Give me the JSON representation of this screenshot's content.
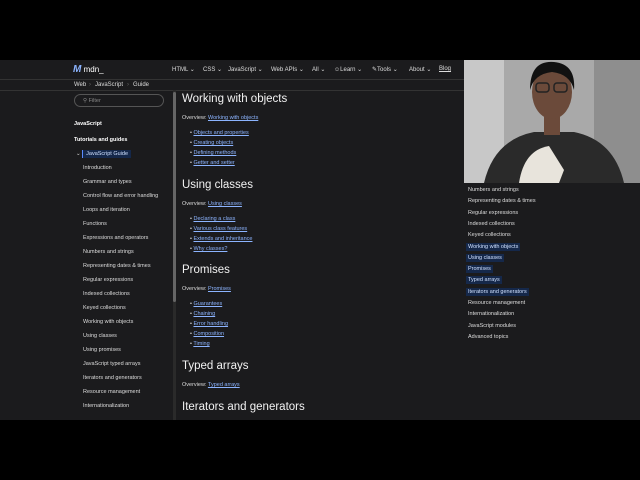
{
  "header": {
    "logo": "mdn_",
    "nav": [
      "HTML",
      "CSS",
      "JavaScript",
      "Web APIs",
      "All",
      "Learn",
      "Tools",
      "About"
    ],
    "blog": "Blog"
  },
  "breadcrumb": [
    "Web",
    "JavaScript",
    "Guide"
  ],
  "sidebar": {
    "filter_placeholder": "Filter",
    "section": "JavaScript",
    "group": "Tutorials and guides",
    "guide": "JavaScript Guide",
    "items": [
      "Introduction",
      "Grammar and types",
      "Control flow and error handling",
      "Loops and iteration",
      "Functions",
      "Expressions and operators",
      "Numbers and strings",
      "Representing dates & times",
      "Regular expressions",
      "Indexed collections",
      "Keyed collections",
      "Working with objects",
      "Using classes",
      "Using promises",
      "JavaScript typed arrays",
      "Iterators and generators",
      "Resource management",
      "Internationalization"
    ]
  },
  "main": {
    "overview_label": "Overview:",
    "sections": [
      {
        "title": "Working with objects",
        "overview": "Working with objects",
        "links": [
          "Objects and properties",
          "Creating objects",
          "Defining methods",
          "Getter and setter"
        ]
      },
      {
        "title": "Using classes",
        "overview": "Using classes",
        "links": [
          "Declaring a class",
          "Various class features",
          "Extends and inheritance",
          "Why classes?"
        ]
      },
      {
        "title": "Promises",
        "overview": "Promises",
        "links": [
          "Guarantees",
          "Chaining",
          "Error handling",
          "Composition",
          "Timing"
        ]
      },
      {
        "title": "Typed arrays",
        "overview": "Typed arrays",
        "links": []
      },
      {
        "title": "Iterators and generators",
        "overview": "",
        "links": []
      }
    ]
  },
  "toc": {
    "items": [
      "Numbers and strings",
      "Representing dates & times",
      "Regular expressions",
      "Indexed collections",
      "Keyed collections",
      "Working with objects",
      "Using classes",
      "Promises",
      "Typed arrays",
      "Iterators and generators",
      "Resource management",
      "Internationalization",
      "JavaScript modules",
      "Advanced topics"
    ],
    "highlighted": [
      5,
      6,
      7,
      8,
      9
    ]
  }
}
